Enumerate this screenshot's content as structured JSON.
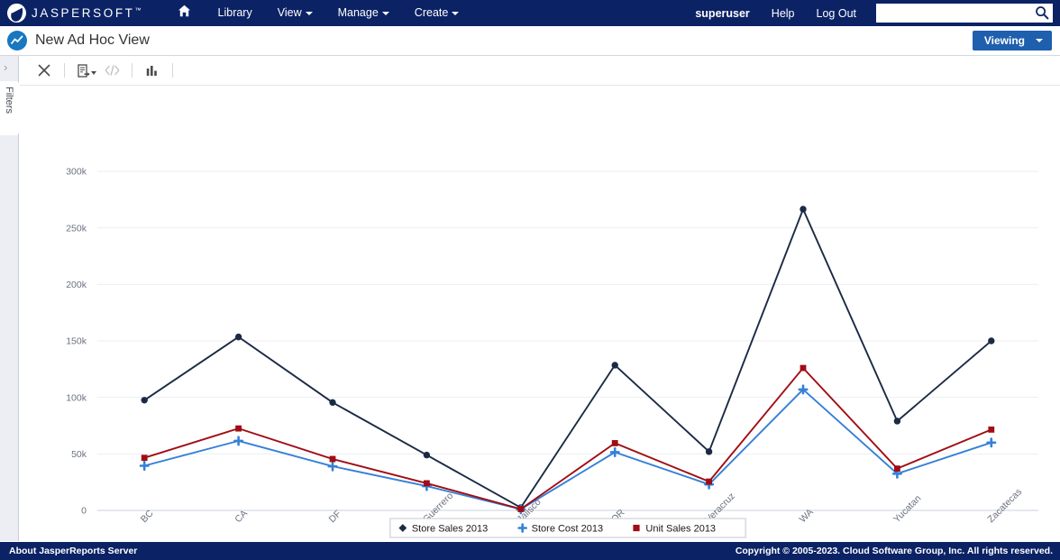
{
  "topnav": {
    "brand": "JASPERSOFT",
    "brand_tm": "™",
    "home_icon": "home-icon",
    "items": [
      {
        "label": "Library",
        "has_caret": false
      },
      {
        "label": "View",
        "has_caret": true
      },
      {
        "label": "Manage",
        "has_caret": true
      },
      {
        "label": "Create",
        "has_caret": true
      }
    ],
    "user": "superuser",
    "help": "Help",
    "logout": "Log Out",
    "search_placeholder": "",
    "search_value": "",
    "search_icon": "search-icon"
  },
  "titlebar": {
    "title": "New Ad Hoc View",
    "icon": "adhoc-view-chart-icon",
    "viewing_label": "Viewing"
  },
  "left_rail": {
    "expand_icon": "chevron-right-icon",
    "tab_label": "Filters"
  },
  "toolbar": {
    "buttons": [
      {
        "name": "close-button",
        "icon": "close-x-icon",
        "disabled": false
      },
      {
        "name": "export-button",
        "icon": "export-icon",
        "disabled": false,
        "has_caret": true
      },
      {
        "name": "view-source-button",
        "icon": "code-brackets-icon",
        "disabled": true
      },
      {
        "name": "chart-type-button",
        "icon": "bar-chart-icon",
        "disabled": false
      }
    ]
  },
  "chart_data": {
    "type": "line",
    "title": "",
    "xlabel": "",
    "ylabel": "",
    "ylim": [
      0,
      300000
    ],
    "yticks": [
      0,
      50000,
      100000,
      150000,
      200000,
      250000,
      300000
    ],
    "ytick_labels": [
      "0",
      "50k",
      "100k",
      "150k",
      "200k",
      "250k",
      "300k"
    ],
    "grid": true,
    "legend_position": "bottom",
    "categories": [
      "BC",
      "CA",
      "DF",
      "Guerrero",
      "Jalisco",
      "OR",
      "Veracruz",
      "WA",
      "Yucatan",
      "Zacatecas"
    ],
    "series": [
      {
        "name": "Store Sales 2013",
        "color": "#1b2a44",
        "marker": "diamond",
        "values": [
          97500,
          153500,
          95500,
          49000,
          2500,
          128500,
          52000,
          266500,
          79000,
          150000
        ]
      },
      {
        "name": "Store Cost 2013",
        "color": "#3580d8",
        "marker": "cross",
        "values": [
          39500,
          61500,
          39000,
          21500,
          1000,
          51500,
          23000,
          107000,
          32500,
          60000
        ]
      },
      {
        "name": "Unit Sales 2013",
        "color": "#a00d14",
        "marker": "square",
        "values": [
          46500,
          72500,
          45500,
          24000,
          1200,
          59500,
          25500,
          126000,
          37000,
          71500
        ]
      }
    ]
  },
  "footer": {
    "about": "About JasperReports Server",
    "copyright": "Copyright © 2005-2023. Cloud Software Group, Inc. All rights reserved."
  }
}
